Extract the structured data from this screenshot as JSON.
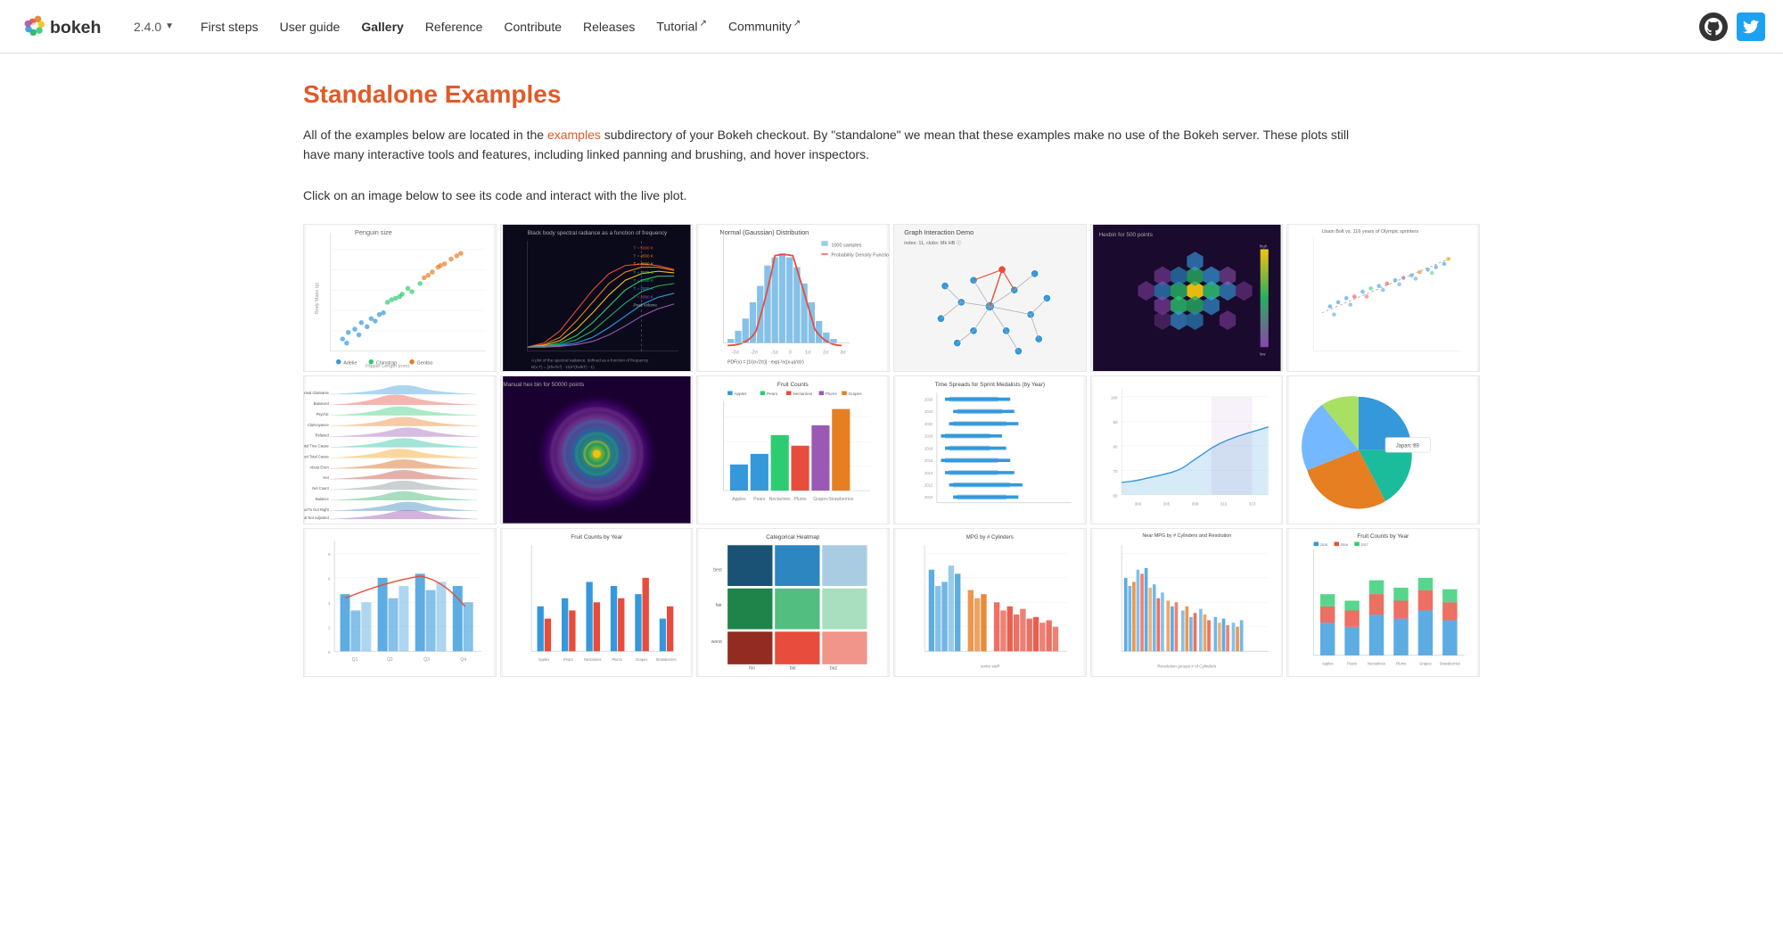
{
  "navbar": {
    "logo_text": "bokeh",
    "version": "2.4.0",
    "nav_items": [
      {
        "label": "First steps",
        "active": false,
        "external": false
      },
      {
        "label": "User guide",
        "active": false,
        "external": false
      },
      {
        "label": "Gallery",
        "active": true,
        "external": false
      },
      {
        "label": "Reference",
        "active": false,
        "external": false
      },
      {
        "label": "Contribute",
        "active": false,
        "external": false
      },
      {
        "label": "Releases",
        "active": false,
        "external": false
      },
      {
        "label": "Tutorial",
        "active": false,
        "external": true
      },
      {
        "label": "Community",
        "active": false,
        "external": true
      }
    ]
  },
  "page": {
    "title": "Standalone Examples",
    "intro_p1": "All of the examples below are located in the",
    "intro_link": "examples",
    "intro_p2": "subdirectory of your Bokeh checkout. By \"standalone\" we mean that these examples make no use of the Bokeh server. These plots still have many interactive tools and features, including linked panning and brushing, and hover inspectors.",
    "click_instruction": "Click on an image below to see its code and interact with the live plot."
  }
}
